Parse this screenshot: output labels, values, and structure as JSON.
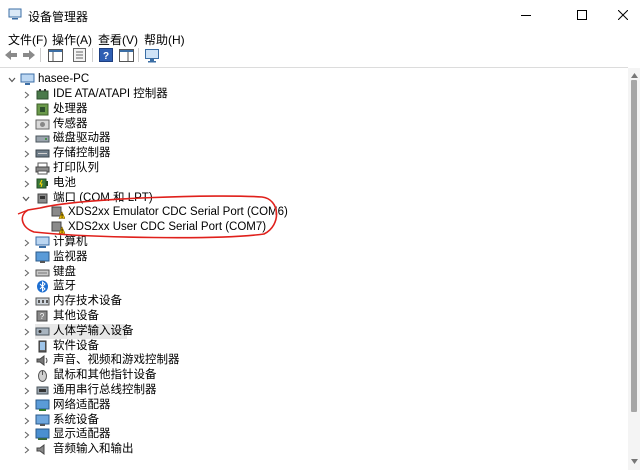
{
  "window": {
    "title": "设备管理器"
  },
  "menu": [
    "文件(F)",
    "操作(A)",
    "查看(V)",
    "帮助(H)"
  ],
  "tree": {
    "root": "hasee-PC",
    "categories": [
      {
        "label": "IDE ATA/ATAPI 控制器",
        "icon": "ide-controller-icon",
        "expanded": false
      },
      {
        "label": "处理器",
        "icon": "processor-icon",
        "expanded": false
      },
      {
        "label": "传感器",
        "icon": "sensor-icon",
        "expanded": false
      },
      {
        "label": "磁盘驱动器",
        "icon": "disk-drive-icon",
        "expanded": false
      },
      {
        "label": "存储控制器",
        "icon": "storage-controller-icon",
        "expanded": false
      },
      {
        "label": "打印队列",
        "icon": "printer-icon",
        "expanded": false
      },
      {
        "label": "电池",
        "icon": "battery-icon",
        "expanded": false
      },
      {
        "label": "端口 (COM 和 LPT)",
        "icon": "port-icon",
        "expanded": true,
        "children": [
          {
            "label": "XDS2xx Emulator CDC Serial Port (COM6)",
            "icon": "warning-port-icon"
          },
          {
            "label": "XDS2xx User CDC Serial Port (COM7)",
            "icon": "warning-port-icon"
          }
        ]
      },
      {
        "label": "计算机",
        "icon": "computer-icon",
        "expanded": false
      },
      {
        "label": "监视器",
        "icon": "monitor-icon",
        "expanded": false
      },
      {
        "label": "键盘",
        "icon": "keyboard-icon",
        "expanded": false
      },
      {
        "label": "蓝牙",
        "icon": "bluetooth-icon",
        "expanded": false
      },
      {
        "label": "内存技术设备",
        "icon": "memory-icon",
        "expanded": false
      },
      {
        "label": "其他设备",
        "icon": "other-device-icon",
        "expanded": false
      },
      {
        "label": "人体学输入设备",
        "icon": "hid-icon",
        "expanded": false,
        "selected": true
      },
      {
        "label": "软件设备",
        "icon": "software-device-icon",
        "expanded": false
      },
      {
        "label": "声音、视频和游戏控制器",
        "icon": "audio-icon",
        "expanded": false
      },
      {
        "label": "鼠标和其他指针设备",
        "icon": "mouse-icon",
        "expanded": false
      },
      {
        "label": "通用串行总线控制器",
        "icon": "usb-icon",
        "expanded": false
      },
      {
        "label": "网络适配器",
        "icon": "network-icon",
        "expanded": false
      },
      {
        "label": "系统设备",
        "icon": "system-device-icon",
        "expanded": false
      },
      {
        "label": "显示适配器",
        "icon": "display-adapter-icon",
        "expanded": false
      },
      {
        "label": "音频输入和输出",
        "icon": "audio-io-icon",
        "expanded": false
      }
    ]
  },
  "colors": {
    "accent": "#0063b1",
    "selection": "#e8e8e8",
    "annotation": "#e0201b",
    "warning": "#f2c200"
  }
}
